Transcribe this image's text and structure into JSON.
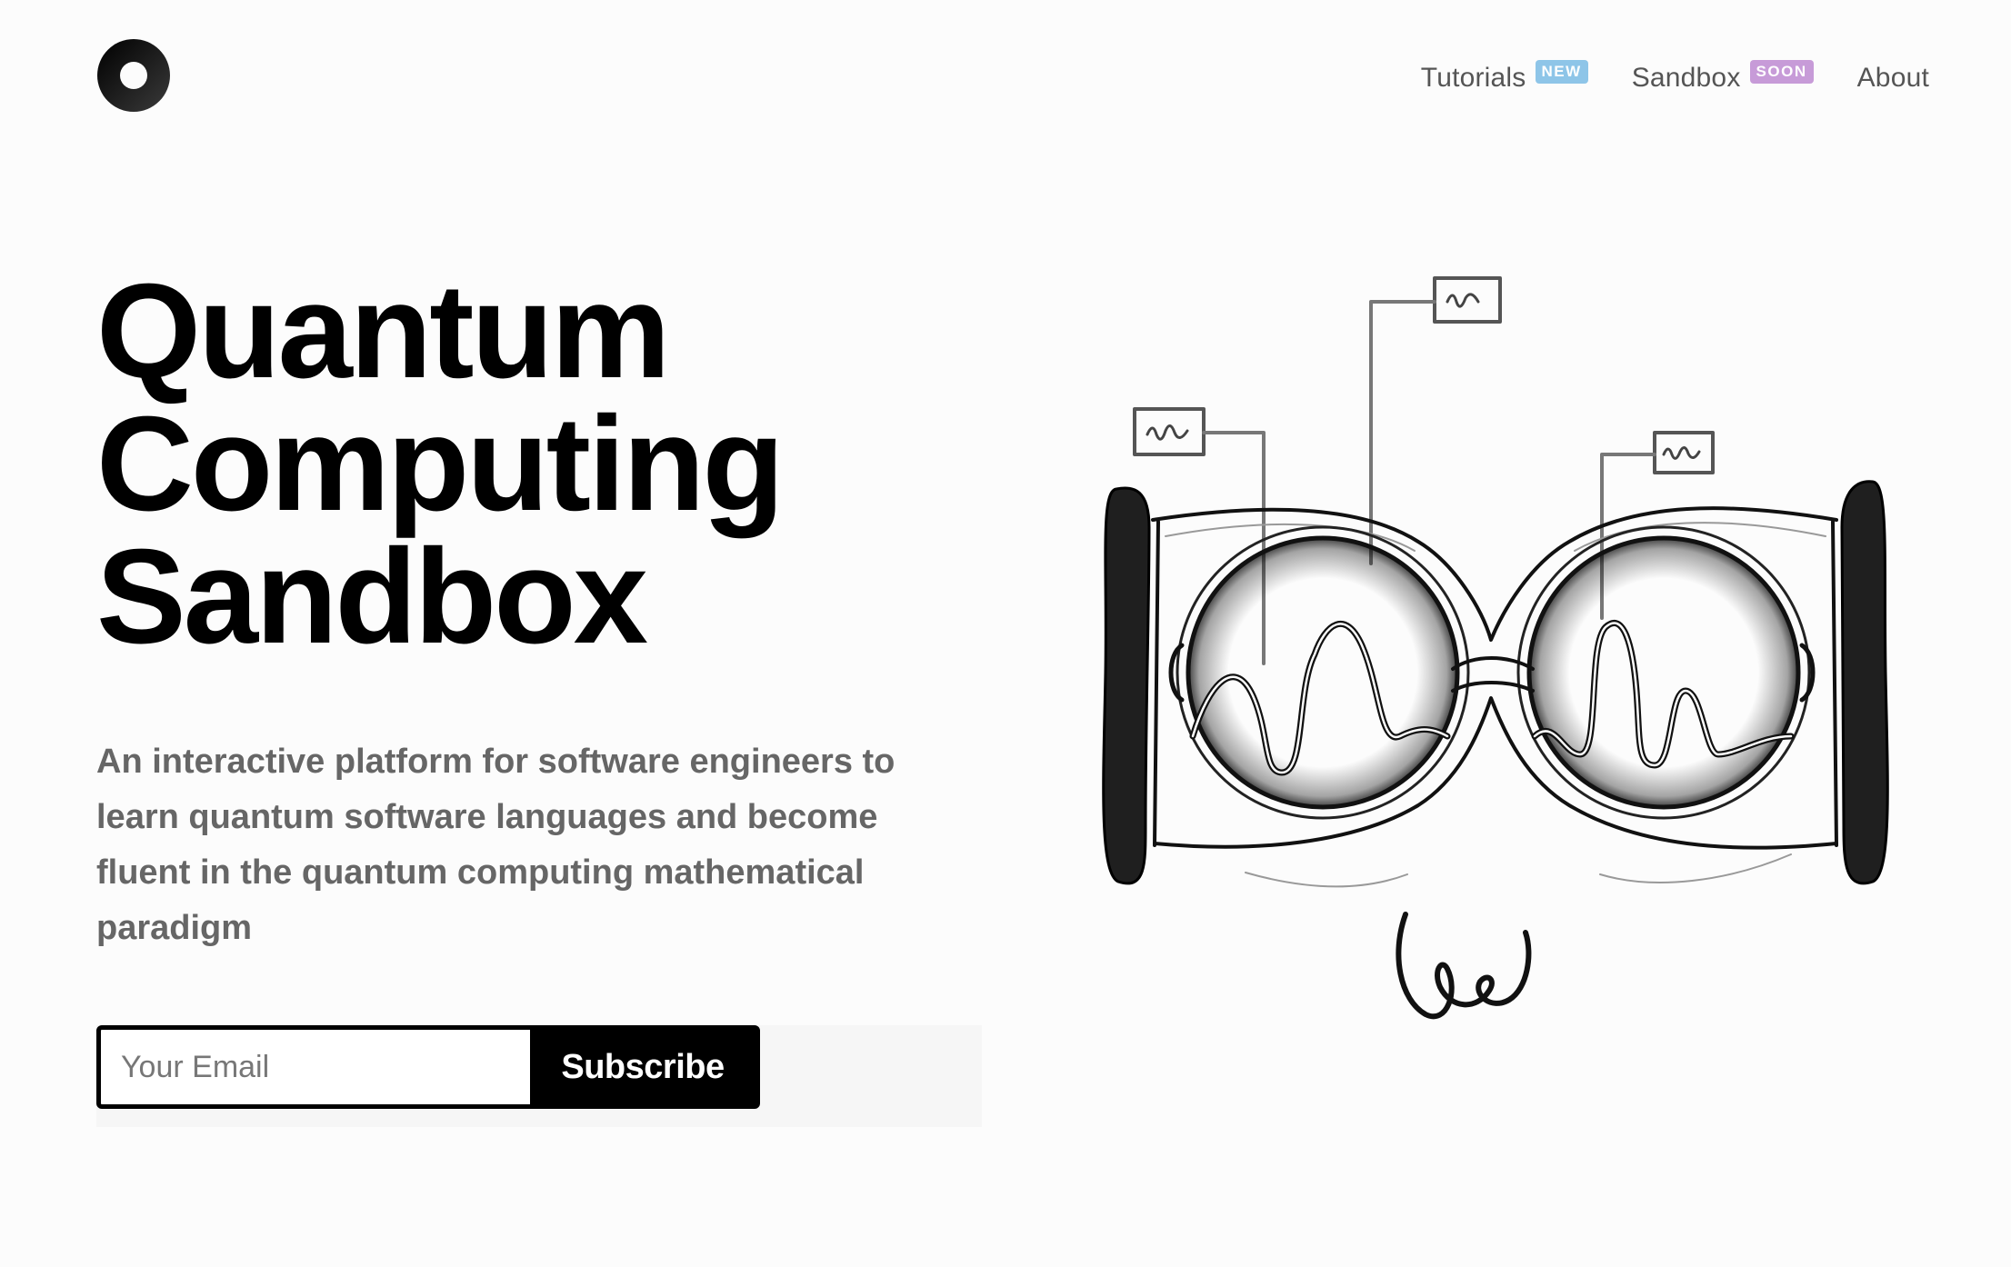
{
  "logo": {
    "icon": "ring-logo-icon"
  },
  "nav": {
    "items": [
      {
        "label": "Tutorials",
        "badge": "NEW",
        "badge_color": "#8ec5e8"
      },
      {
        "label": "Sandbox",
        "badge": "SOON",
        "badge_color": "#c79bd8"
      },
      {
        "label": "About"
      }
    ]
  },
  "hero": {
    "title_lines": [
      "Quantum",
      "Computing",
      "Sandbox"
    ],
    "description": "An interactive platform for software engineers to learn quantum software languages and become fluent in the quantum computing mathematical paradigm"
  },
  "subscribe": {
    "placeholder": "Your Email",
    "button_label": "Subscribe"
  },
  "illustration": {
    "icon": "quantum-goggles-sketch-icon"
  },
  "colors": {
    "text_primary": "#000000",
    "text_secondary": "#666666",
    "nav_text": "#555555",
    "background": "#fcfcfc"
  }
}
